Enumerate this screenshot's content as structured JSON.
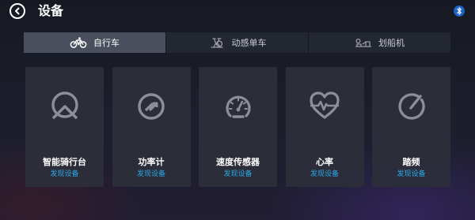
{
  "header": {
    "title": "设备",
    "back_icon": "chevron-left-icon",
    "bluetooth_icon": "bluetooth-icon"
  },
  "tabs": [
    {
      "label": "自行车",
      "icon": "bicycle-icon",
      "active": true
    },
    {
      "label": "动感单车",
      "icon": "spin-bike-icon",
      "active": false
    },
    {
      "label": "划船机",
      "icon": "rowing-machine-icon",
      "active": false
    }
  ],
  "devices": [
    {
      "label": "智能骑行台",
      "status": "发现设备",
      "icon": "smart-trainer-icon"
    },
    {
      "label": "功率计",
      "status": "发现设备",
      "icon": "power-meter-icon"
    },
    {
      "label": "速度传感器",
      "status": "发现设备",
      "icon": "speedometer-icon"
    },
    {
      "label": "心率",
      "status": "发现设备",
      "icon": "heart-rate-icon"
    },
    {
      "label": "踏频",
      "status": "发现设备",
      "icon": "cadence-icon"
    }
  ],
  "colors": {
    "accent": "#2aa8e8",
    "active_tab": "#4a4f5e",
    "card": "#2c2f3a",
    "icon": "#8c8f99"
  }
}
